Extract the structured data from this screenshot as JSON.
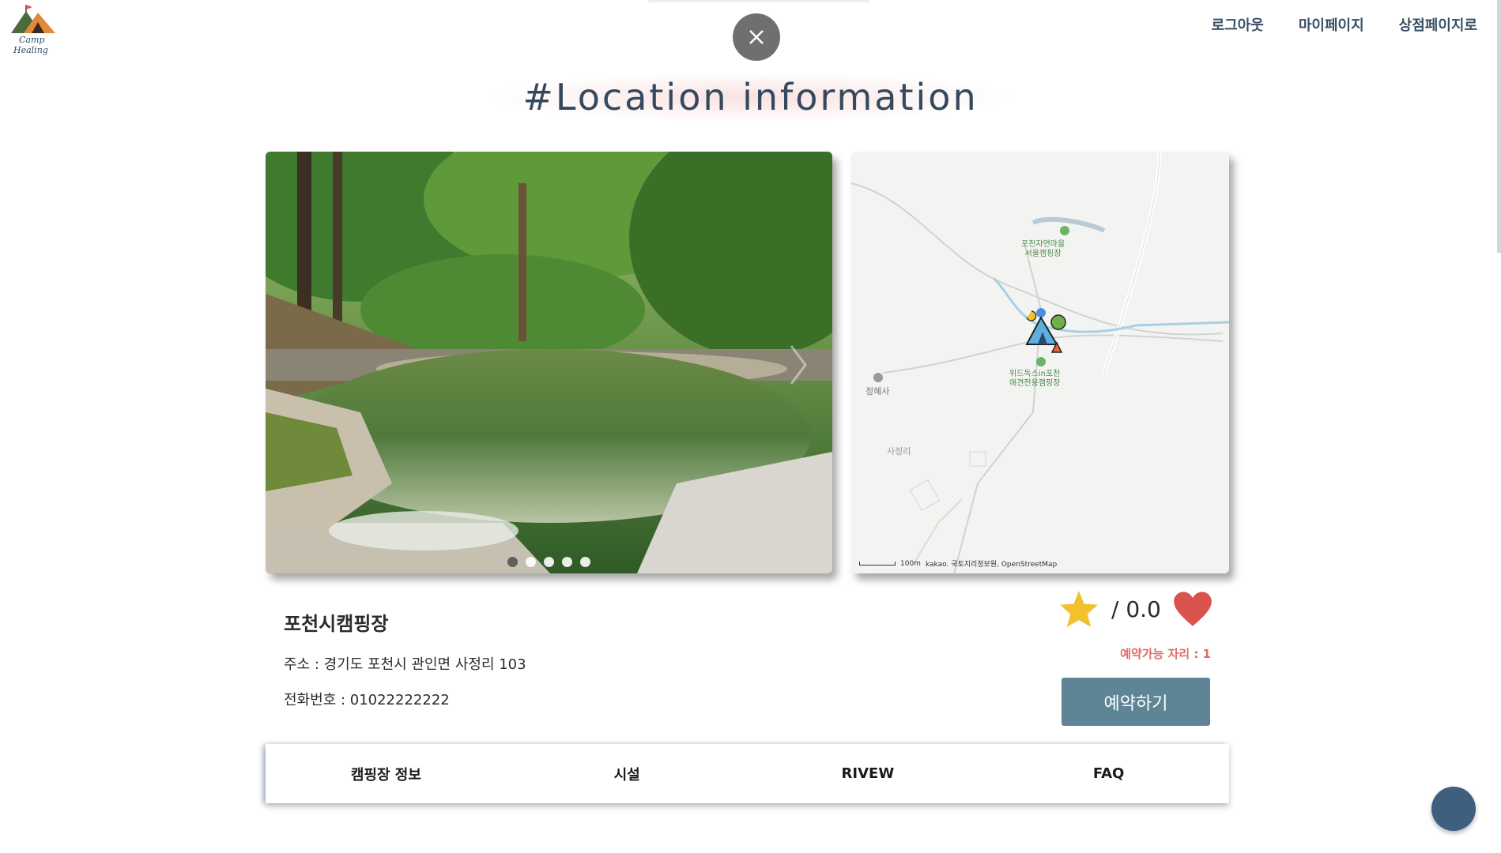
{
  "logo": {
    "line1": "Camp",
    "line2": "Healing"
  },
  "nav": {
    "logout": "로그아웃",
    "mypage": "마이페이지",
    "shop": "상점페이지로"
  },
  "heading": "#Location information",
  "carousel": {
    "slides": 5,
    "active": 1
  },
  "map": {
    "label1": "포천자연마을\n서울캠핑장",
    "label2": "위드독스in포천\n애견전용캠핑장",
    "label3": "정혜사",
    "label4": "사정리",
    "scale": "100m",
    "attribution": "kakao. 국토지리정보원, OpenStreetMap"
  },
  "camp": {
    "name": "포천시캠핑장",
    "address": "주소 : 경기도 포천시 관인면 사정리 103",
    "phone": "전화번호 : 01022222222"
  },
  "rating": {
    "value": "/ 0.0"
  },
  "availability": "예약가능 자리 : 1",
  "reserve_label": "예약하기",
  "tabs": [
    "캠핑장 정보",
    "시설",
    "RIVEW",
    "FAQ"
  ],
  "colors": {
    "accent": "#5e8596",
    "heart": "#d9534f",
    "star": "#f2c12e",
    "nav": "#3a4f66"
  }
}
